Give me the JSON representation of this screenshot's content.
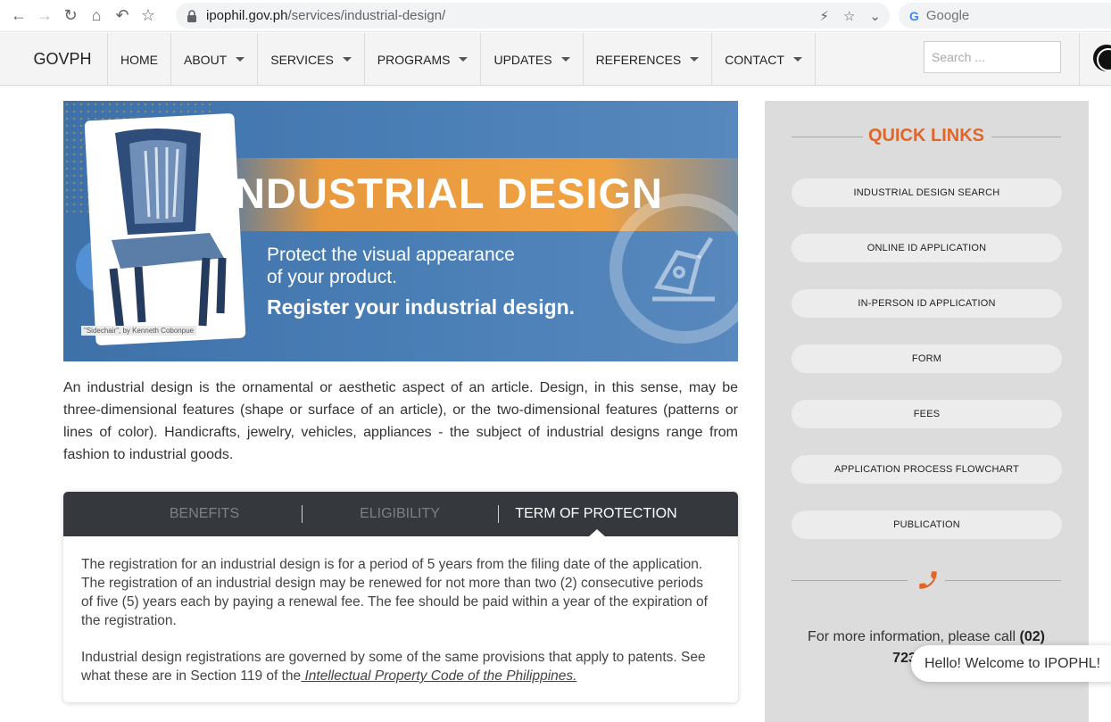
{
  "browser": {
    "url_host": "ipophil.gov.ph",
    "url_path": "/services/industrial-design/",
    "search_placeholder": "Google"
  },
  "header": {
    "brand": "GOVPH",
    "menu": [
      {
        "label": "HOME",
        "has_caret": false
      },
      {
        "label": "ABOUT",
        "has_caret": true
      },
      {
        "label": "SERVICES",
        "has_caret": true
      },
      {
        "label": "PROGRAMS",
        "has_caret": true
      },
      {
        "label": "UPDATES",
        "has_caret": true
      },
      {
        "label": "REFERENCES",
        "has_caret": true
      },
      {
        "label": "CONTACT",
        "has_caret": true
      }
    ],
    "search_placeholder": "Search ..."
  },
  "banner": {
    "title": "INDUSTRIAL DESIGN",
    "line1": "Protect the visual appearance",
    "line2": "of your product.",
    "line3": "Register your industrial design.",
    "caption": "\"Sidechair\", by Kenneth Cobonpue"
  },
  "description": "An industrial design is the ornamental or aesthetic aspect of an article. Design, in this sense, may be three-dimensional features (shape or surface of an article), or the two-dimensional features (patterns or lines of color). Handicrafts, jewelry, vehicles, appliances - the subject of industrial designs range from fashion to industrial goods.",
  "tabs": {
    "items": [
      "BENEFITS",
      "ELIGIBILITY",
      "TERM OF PROTECTION"
    ],
    "active": "TERM OF PROTECTION",
    "content_p1": "The registration for an industrial design is for a period of 5 years from the filing date of the application. The registration of an industrial design may be renewed for not more than two (2) consecutive periods of five (5) years each by paying a renewal fee. The fee should be paid within a year of the expiration of the registration.",
    "content_p2_prefix": "Industrial design registrations are governed by some of the same provisions that apply to patents. See what these are in Section 119  of the",
    "content_p2_link": " Intellectual Property Code of the Philippines. "
  },
  "sidebar": {
    "title": "QUICK LINKS",
    "links": [
      "INDUSTRIAL DESIGN SEARCH",
      "ONLINE ID APPLICATION",
      "IN-PERSON ID APPLICATION",
      "FORM",
      "FEES",
      "APPLICATION PROCESS FLOWCHART",
      "PUBLICATION"
    ],
    "info_prefix": "For more information, please call ",
    "info_phone_a": "(02)",
    "info_phone_b": "7238 6300"
  },
  "chat": {
    "message": "Hello! Welcome to IPOPHL!"
  },
  "colors": {
    "accent": "#e0662a",
    "tab_bar": "#35383d",
    "sidebar_bg": "#dcdcdc"
  }
}
